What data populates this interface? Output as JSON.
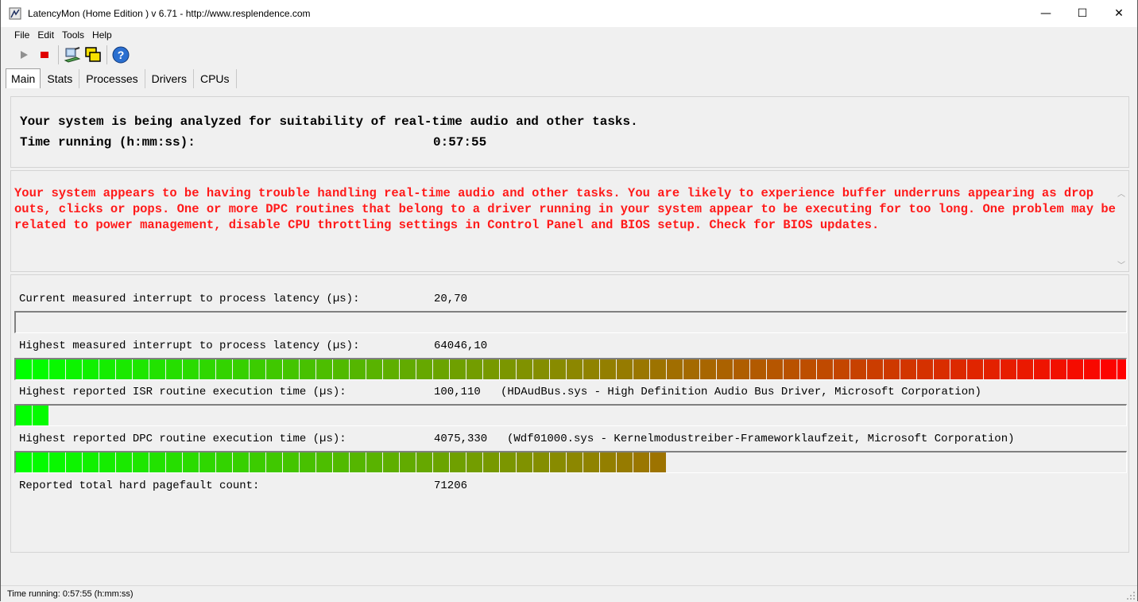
{
  "window": {
    "title": "LatencyMon  (Home Edition )  v 6.71 - http://www.resplendence.com",
    "min_glyph": "—",
    "max_glyph": "☐",
    "close_glyph": "✕"
  },
  "menu": [
    "File",
    "Edit",
    "Tools",
    "Help"
  ],
  "toolbar": {
    "icons": [
      "play-icon",
      "stop-icon",
      "computer-icon",
      "windows-icon",
      "help-icon"
    ]
  },
  "tabs": [
    "Main",
    "Stats",
    "Processes",
    "Drivers",
    "CPUs"
  ],
  "status_panel": {
    "line1": "Your system is being analyzed for suitability of real-time audio and other tasks.",
    "time_label": "Time running (h:mm:ss):",
    "time_value": "0:57:55"
  },
  "warning": {
    "text": "Your system appears to be having trouble handling real-time audio and other tasks. You are likely to experience buffer underruns appearing as drop outs, clicks or pops. One or more DPC routines that belong to a driver running in your system appear to be executing for too long. One problem may be related to power management, disable CPU throttling settings in Control Panel and BIOS setup. Check for BIOS updates.",
    "color": "#ff1a1a"
  },
  "metrics": {
    "current_label": "Current measured interrupt to process latency (µs):",
    "current_value": "20,70",
    "highest_label": "Highest measured interrupt to process latency (µs):",
    "highest_value": "64046,10",
    "isr_label": "Highest reported ISR routine execution time (µs):",
    "isr_value": "100,110",
    "isr_driver": "(HDAudBus.sys - High Definition Audio Bus Driver, Microsoft Corporation)",
    "dpc_label": "Highest reported DPC routine execution time (µs):",
    "dpc_value": "4075,330",
    "dpc_driver": "(Wdf01000.sys - Kernelmodustreiber-Frameworklaufzeit, Microsoft Corporation)",
    "pagefault_label": "Reported total hard pagefault count:",
    "pagefault_value": "71206"
  },
  "bars": {
    "current_fraction": 0.0,
    "highest_fraction": 1.0,
    "isr_fraction": 0.03,
    "dpc_fraction": 0.58
  },
  "statusbar": {
    "text": "Time running: 0:57:55  (h:mm:ss)"
  }
}
